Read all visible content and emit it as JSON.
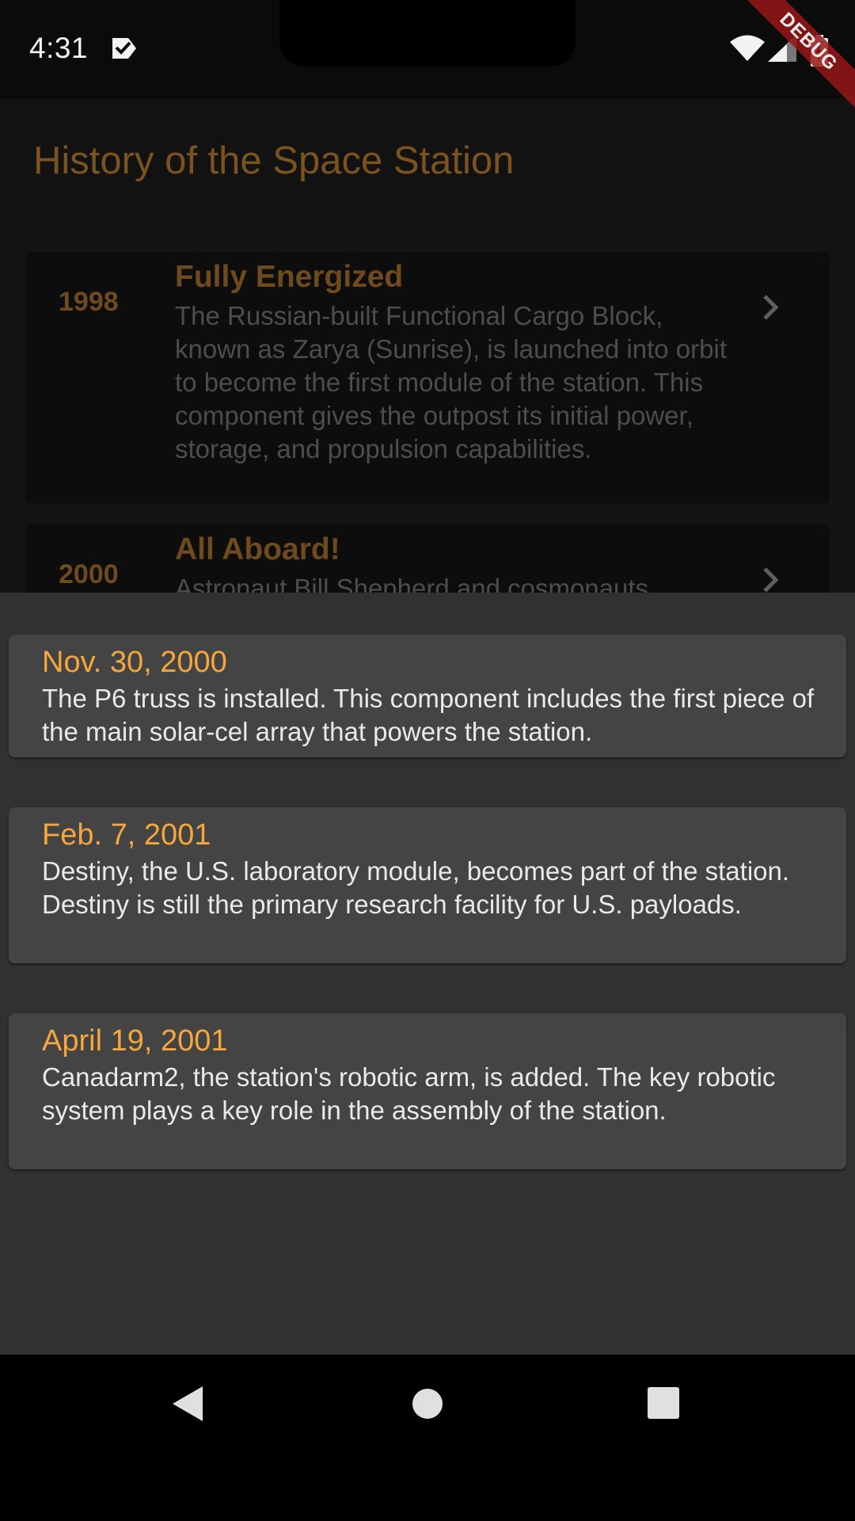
{
  "status_bar": {
    "time": "4:31",
    "icons": [
      "notification-check-icon",
      "wifi-icon",
      "cell-signal-icon",
      "battery-icon"
    ],
    "debug_label": "DEBUG"
  },
  "app_bar": {
    "title": "History of the Space Station"
  },
  "timeline": [
    {
      "year": "1998",
      "title": "Fully Energized",
      "description": "The Russian-built Functional Cargo Block, known as Zarya (Sunrise), is launched into orbit to become the first module of the station. This component gives the outpost its initial power, storage, and propulsion capabilities."
    },
    {
      "year": "2000",
      "title": "All Aboard!",
      "description": "Astronaut Bill Shepherd and cosmonauts"
    }
  ],
  "sheet": {
    "events": [
      {
        "date": "Nov. 30, 2000",
        "text": "The P6 truss is installed. This component includes the first piece of the main solar-cel array that powers the station."
      },
      {
        "date": "Feb. 7, 2001",
        "text": "Destiny, the U.S. laboratory module, becomes part of the station. Destiny is still the primary research facility for U.S. payloads."
      },
      {
        "date": "April 19, 2001",
        "text": "Canadarm2, the station's robotic arm, is added. The key robotic system plays a key role in the assembly of the station."
      }
    ]
  },
  "colors": {
    "accent": "#f5a63c",
    "title_dim": "#7b531f",
    "sheet_bg": "#313131",
    "card_bg": "#444444"
  }
}
